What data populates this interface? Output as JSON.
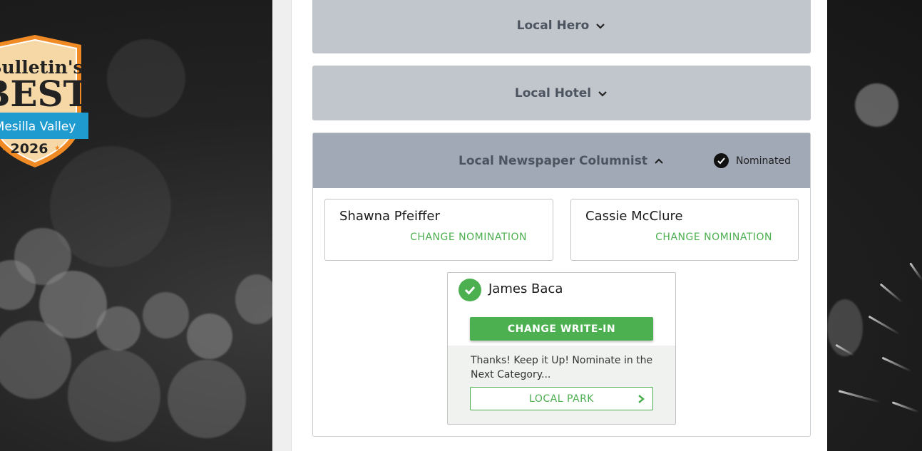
{
  "logo": {
    "line1": "Bulletin's",
    "line2": "BEST",
    "ribbon": "Mesilla Valley",
    "year": "2026",
    "colors": {
      "badge": "#f6d7a6",
      "border": "#f08a24",
      "ribbon": "#1f9bd0",
      "text": "#222222"
    }
  },
  "categories_collapsed": [
    {
      "title": "Local Hero",
      "icon": "chevron-down-icon"
    },
    {
      "title": "Local Hotel",
      "icon": "chevron-down-icon"
    }
  ],
  "category_open": {
    "title": "Local Newspaper Columnist",
    "icon": "chevron-up-icon",
    "status": {
      "label": "Nominated",
      "icon": "check-circle-icon"
    },
    "nominees": [
      {
        "name": "Shawna Pfeiffer",
        "action": "CHANGE NOMINATION"
      },
      {
        "name": "Cassie McClure",
        "action": "CHANGE NOMINATION"
      }
    ],
    "write_in": {
      "name": "James Baca",
      "icon": "check-circle-icon",
      "action": "CHANGE WRITE-IN",
      "message": "Thanks! Keep it Up! Nominate in the Next Category...",
      "next_category": "LOCAL PARK",
      "next_icon": "chevron-right-icon"
    }
  },
  "colors": {
    "accent_green": "#4caf50",
    "collapsed_header": "#c1c6cc",
    "open_header": "#a0a9b5",
    "header_text": "#4c5460"
  }
}
